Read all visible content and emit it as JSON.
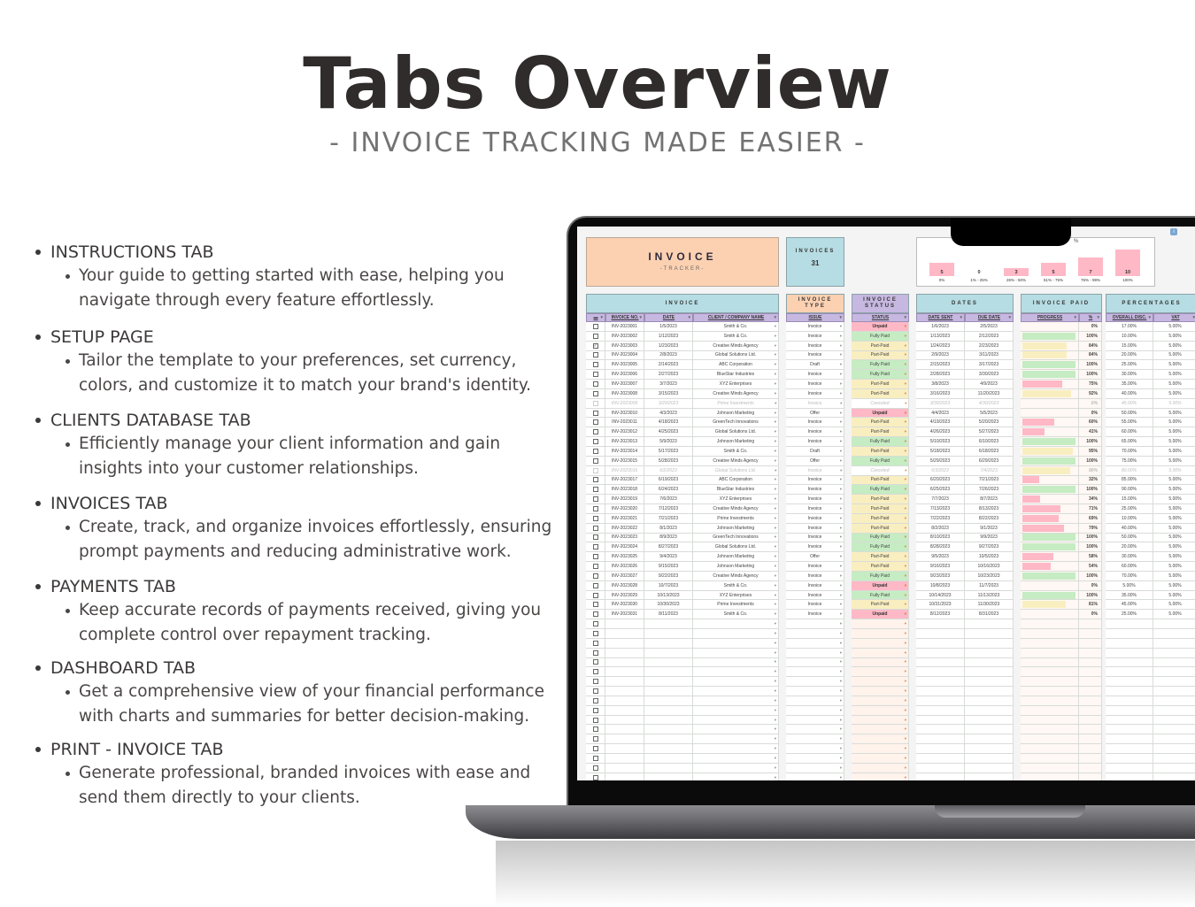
{
  "page": {
    "title": "Tabs Overview",
    "subtitle": "- INVOICE TRACKING MADE EASIER -"
  },
  "features": [
    {
      "title": "INSTRUCTIONS TAB",
      "desc": "Your guide to getting started with ease, helping you navigate through every feature effortlessly."
    },
    {
      "title": "SETUP PAGE",
      "desc": " Tailor the template to your preferences, set currency, colors, and customize it to match your brand's identity."
    },
    {
      "title": "CLIENTS DATABASE TAB",
      "desc": "Efficiently manage your client information and gain insights into your customer relationships."
    },
    {
      "title": "INVOICES TAB",
      "desc": "Create, track, and organize invoices effortlessly, ensuring prompt payments and reducing administrative work."
    },
    {
      "title": "PAYMENTS TAB",
      "desc": "Keep accurate records of payments received, giving you complete control over repayment tracking."
    },
    {
      "title": "DASHBOARD TAB",
      "desc": "Get a comprehensive view of your financial performance with charts and summaries for better decision-making."
    },
    {
      "title": "PRINT - INVOICE TAB",
      "desc": "Generate professional, branded invoices with ease and send them directly to your clients."
    }
  ],
  "sheet": {
    "title": "INVOICE",
    "subtitle": "-TRACKER-",
    "count_label": "INVOICES",
    "count_value": "31",
    "chart": {
      "pct_label": "%",
      "categories": [
        "0%",
        "1% - 25%",
        "26% - 50%",
        "51% - 75%",
        "76% - 99%",
        "100%"
      ],
      "values": [
        5,
        0,
        3,
        5,
        7,
        10
      ]
    },
    "sections": {
      "invoice": "INVOICE",
      "type": "INVOICE TYPE",
      "status": "INVOICE STATUS",
      "dates": "DATES",
      "paid": "INVOICE PAID",
      "percentages": "PERCENTAGES"
    },
    "columns": {
      "invoice_no": "INVOICE NO.",
      "date": "DATE",
      "client": "CLIENT / COMPANY NAME",
      "issue": "ISSUE",
      "status": "STATUS",
      "date_sent": "DATE SENT",
      "due_date": "DUE DATE",
      "progress": "PROGRESS",
      "pct": "%",
      "discount": "OVERALL DISC.",
      "vat": "VAT"
    },
    "colors": {
      "unpaid": "#ffb8c6",
      "fully_paid": "#c5ecc2",
      "part_paid": "#f9eec0"
    },
    "rows": [
      {
        "checked": false,
        "no": "INV-2023001",
        "date": "1/5/2023",
        "client": "Smith & Co.",
        "issue": "Invoice",
        "status": "Unpaid",
        "sent": "1/6/2023",
        "due": "2/5/2023",
        "pct": 0,
        "disc": "17.00%",
        "vat": "5.00%"
      },
      {
        "checked": false,
        "no": "INV-2023002",
        "date": "1/12/2023",
        "client": "Smith & Co.",
        "issue": "Invoice",
        "status": "Fully Paid",
        "sent": "1/13/2023",
        "due": "2/12/2023",
        "pct": 100,
        "disc": "10.00%",
        "vat": "5.00%"
      },
      {
        "checked": true,
        "no": "INV-2023003",
        "date": "1/23/2023",
        "client": "Creative Minds Agency",
        "issue": "Invoice",
        "status": "Part-Paid",
        "sent": "1/24/2023",
        "due": "2/23/2023",
        "pct": 84,
        "disc": "15.00%",
        "vat": "5.00%"
      },
      {
        "checked": false,
        "no": "INV-2023004",
        "date": "2/8/2023",
        "client": "Global Solutions Ltd.",
        "issue": "Invoice",
        "status": "Part-Paid",
        "sent": "2/9/2023",
        "due": "3/11/2023",
        "pct": 84,
        "disc": "20.00%",
        "vat": "5.00%"
      },
      {
        "checked": false,
        "no": "INV-2023005",
        "date": "2/14/2023",
        "client": "ABC Corporation",
        "issue": "Draft",
        "status": "Fully Paid",
        "sent": "2/15/2023",
        "due": "3/17/2023",
        "pct": 100,
        "disc": "25.00%",
        "vat": "5.00%"
      },
      {
        "checked": false,
        "no": "INV-2023006",
        "date": "2/27/2023",
        "client": "BlueStar Industries",
        "issue": "Invoice",
        "status": "Fully Paid",
        "sent": "2/28/2023",
        "due": "3/30/2023",
        "pct": 100,
        "disc": "30.00%",
        "vat": "5.00%"
      },
      {
        "checked": false,
        "no": "INV-2023007",
        "date": "3/7/2023",
        "client": "XYZ Enterprises",
        "issue": "Invoice",
        "status": "Part-Paid",
        "sent": "3/8/2023",
        "due": "4/9/2023",
        "pct": 75,
        "disc": "35.00%",
        "vat": "5.00%"
      },
      {
        "checked": false,
        "no": "INV-2023008",
        "date": "3/15/2023",
        "client": "Creative Minds Agency",
        "issue": "Invoice",
        "status": "Part-Paid",
        "sent": "3/16/2023",
        "due": "11/20/2023",
        "pct": 92,
        "disc": "40.00%",
        "vat": "5.00%"
      },
      {
        "checked": false,
        "no": "INV-2023009",
        "date": "3/29/2023",
        "client": "Prime Investments",
        "issue": "Invoice",
        "status": "Canceled",
        "sent": "3/30/2023",
        "due": "4/30/2023",
        "pct": 0,
        "disc": "45.00%",
        "vat": "5.00%"
      },
      {
        "checked": false,
        "no": "INV-2023010",
        "date": "4/3/2023",
        "client": "Johnson Marketing",
        "issue": "Offer",
        "status": "Unpaid",
        "sent": "4/4/2023",
        "due": "5/5/2023",
        "pct": 0,
        "disc": "50.00%",
        "vat": "5.00%"
      },
      {
        "checked": false,
        "no": "INV-2023011",
        "date": "4/18/2023",
        "client": "GreenTech Innovations",
        "issue": "Invoice",
        "status": "Part-Paid",
        "sent": "4/19/2023",
        "due": "5/20/2023",
        "pct": 60,
        "disc": "55.00%",
        "vat": "5.00%"
      },
      {
        "checked": false,
        "no": "INV-2023012",
        "date": "4/25/2023",
        "client": "Global Solutions Ltd.",
        "issue": "Invoice",
        "status": "Part-Paid",
        "sent": "4/26/2023",
        "due": "5/27/2023",
        "pct": 41,
        "disc": "60.00%",
        "vat": "5.00%"
      },
      {
        "checked": false,
        "no": "INV-2023013",
        "date": "5/9/2023",
        "client": "Johnson Marketing",
        "issue": "Invoice",
        "status": "Fully Paid",
        "sent": "5/10/2023",
        "due": "6/10/2023",
        "pct": 100,
        "disc": "65.00%",
        "vat": "5.00%"
      },
      {
        "checked": false,
        "no": "INV-2023014",
        "date": "5/17/2023",
        "client": "Smith & Co.",
        "issue": "Draft",
        "status": "Part-Paid",
        "sent": "5/18/2023",
        "due": "6/18/2023",
        "pct": 95,
        "disc": "70.00%",
        "vat": "5.00%"
      },
      {
        "checked": false,
        "no": "INV-2023015",
        "date": "5/28/2023",
        "client": "Creative Minds Agency",
        "issue": "Offer",
        "status": "Fully Paid",
        "sent": "5/29/2023",
        "due": "6/29/2023",
        "pct": 100,
        "disc": "75.00%",
        "vat": "5.00%"
      },
      {
        "checked": false,
        "no": "INV-2023016",
        "date": "6/2/2023",
        "client": "Global Solutions Ltd.",
        "issue": "Invoice",
        "status": "Canceled",
        "sent": "6/3/2023",
        "due": "7/4/2023",
        "pct": 90,
        "disc": "80.00%",
        "vat": "5.00%"
      },
      {
        "checked": false,
        "no": "INV-2023017",
        "date": "6/19/2023",
        "client": "ABC Corporation",
        "issue": "Invoice",
        "status": "Part-Paid",
        "sent": "6/20/2023",
        "due": "7/21/2023",
        "pct": 32,
        "disc": "85.00%",
        "vat": "5.00%"
      },
      {
        "checked": false,
        "no": "INV-2023018",
        "date": "6/24/2023",
        "client": "BlueStar Industries",
        "issue": "Invoice",
        "status": "Fully Paid",
        "sent": "6/25/2023",
        "due": "7/26/2023",
        "pct": 100,
        "disc": "90.00%",
        "vat": "5.00%"
      },
      {
        "checked": false,
        "no": "INV-2023019",
        "date": "7/6/2023",
        "client": "XYZ Enterprises",
        "issue": "Invoice",
        "status": "Part-Paid",
        "sent": "7/7/2023",
        "due": "8/7/2023",
        "pct": 34,
        "disc": "15.00%",
        "vat": "5.00%"
      },
      {
        "checked": false,
        "no": "INV-2023020",
        "date": "7/12/2023",
        "client": "Creative Minds Agency",
        "issue": "Invoice",
        "status": "Part-Paid",
        "sent": "7/13/2023",
        "due": "8/13/2023",
        "pct": 71,
        "disc": "25.00%",
        "vat": "5.00%"
      },
      {
        "checked": false,
        "no": "INV-2023021",
        "date": "7/21/2023",
        "client": "Prime Investments",
        "issue": "Invoice",
        "status": "Part-Paid",
        "sent": "7/22/2023",
        "due": "8/22/2023",
        "pct": 69,
        "disc": "10.00%",
        "vat": "5.00%"
      },
      {
        "checked": false,
        "no": "INV-2023022",
        "date": "8/1/2023",
        "client": "Johnson Marketing",
        "issue": "Invoice",
        "status": "Part-Paid",
        "sent": "8/2/2023",
        "due": "9/1/2023",
        "pct": 79,
        "disc": "40.00%",
        "vat": "5.00%"
      },
      {
        "checked": false,
        "no": "INV-2023023",
        "date": "8/9/2023",
        "client": "GreenTech Innovations",
        "issue": "Invoice",
        "status": "Fully Paid",
        "sent": "8/10/2023",
        "due": "9/9/2023",
        "pct": 100,
        "disc": "50.00%",
        "vat": "5.00%"
      },
      {
        "checked": false,
        "no": "INV-2023024",
        "date": "8/27/2023",
        "client": "Global Solutions Ltd.",
        "issue": "Invoice",
        "status": "Fully Paid",
        "sent": "8/28/2023",
        "due": "9/27/2023",
        "pct": 100,
        "disc": "20.00%",
        "vat": "5.00%"
      },
      {
        "checked": false,
        "no": "INV-2023025",
        "date": "9/4/2023",
        "client": "Johnson Marketing",
        "issue": "Offer",
        "status": "Part-Paid",
        "sent": "9/5/2023",
        "due": "10/5/2023",
        "pct": 58,
        "disc": "30.00%",
        "vat": "5.00%"
      },
      {
        "checked": false,
        "no": "INV-2023026",
        "date": "9/15/2023",
        "client": "Johnson Marketing",
        "issue": "Invoice",
        "status": "Part-Paid",
        "sent": "9/16/2023",
        "due": "10/16/2023",
        "pct": 54,
        "disc": "60.00%",
        "vat": "5.00%"
      },
      {
        "checked": false,
        "no": "INV-2023027",
        "date": "9/22/2023",
        "client": "Creative Minds Agency",
        "issue": "Invoice",
        "status": "Fully Paid",
        "sent": "9/23/2023",
        "due": "10/23/2023",
        "pct": 100,
        "disc": "70.00%",
        "vat": "5.00%"
      },
      {
        "checked": false,
        "no": "INV-2023028",
        "date": "10/7/2023",
        "client": "Smith & Co.",
        "issue": "Invoice",
        "status": "Unpaid",
        "sent": "10/8/2023",
        "due": "11/7/2023",
        "pct": 0,
        "disc": "5.00%",
        "vat": "5.00%"
      },
      {
        "checked": false,
        "no": "INV-2023029",
        "date": "10/13/2023",
        "client": "XYZ Enterprises",
        "issue": "Invoice",
        "status": "Fully Paid",
        "sent": "10/14/2023",
        "due": "11/13/2023",
        "pct": 100,
        "disc": "35.00%",
        "vat": "5.00%"
      },
      {
        "checked": false,
        "no": "INV-2023030",
        "date": "10/30/2023",
        "client": "Prime Investments",
        "issue": "Invoice",
        "status": "Part-Paid",
        "sent": "10/31/2023",
        "due": "11/30/2023",
        "pct": 81,
        "disc": "45.00%",
        "vat": "5.00%"
      },
      {
        "checked": false,
        "no": "INV-2023031",
        "date": "8/11/2023",
        "client": "Smith & Co.",
        "issue": "Invoice",
        "status": "Unpaid",
        "sent": "8/12/2023",
        "due": "8/31/2023",
        "pct": 0,
        "disc": "25.00%",
        "vat": "5.00%"
      }
    ]
  }
}
